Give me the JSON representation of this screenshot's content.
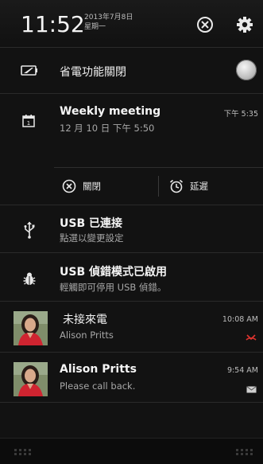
{
  "status": {
    "time": "11:52",
    "date": "2013年7月8日",
    "weekday": "星期一"
  },
  "quick_settings": {
    "power_saver_label": "省電功能關閉",
    "power_saver_on": false
  },
  "calendar": {
    "title": "Weekly meeting",
    "subtitle": "12 月 10 日 下午 5:50",
    "time": "下午 5:35",
    "dismiss_label": "關閉",
    "snooze_label": "延遲"
  },
  "usb_connected": {
    "title": "USB 已連接",
    "subtitle": "點選以變更設定"
  },
  "usb_debug": {
    "title": "USB 偵錯模式已啟用",
    "subtitle": "輕觸即可停用 USB 偵錯。"
  },
  "missed_call": {
    "title": "未接來電",
    "name": "Alison Pritts",
    "time": "10:08 AM"
  },
  "message": {
    "title": "Alison Pritts",
    "body": "Please call back.",
    "time": "9:54 AM"
  },
  "colors": {
    "accent_red": "#e0342f",
    "background": "#121212"
  }
}
